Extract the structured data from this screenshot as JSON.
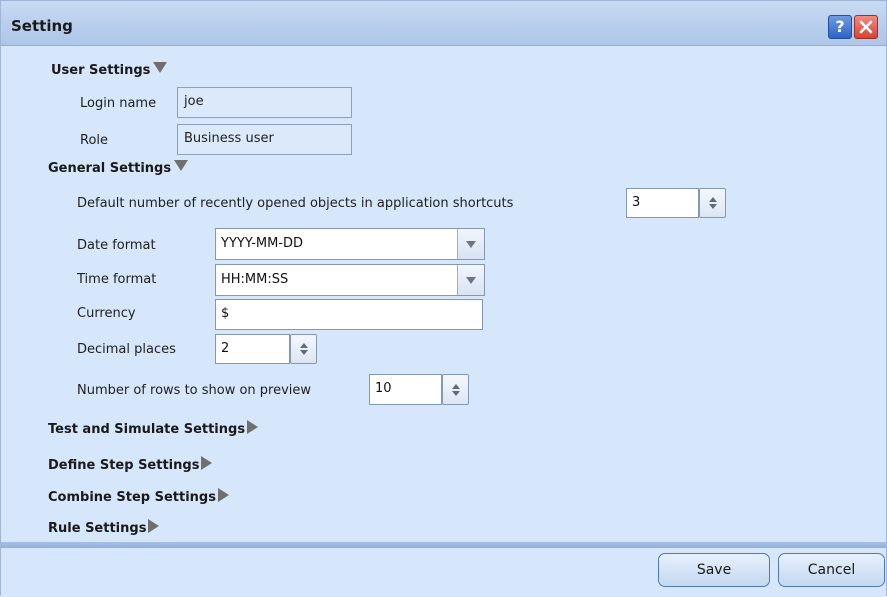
{
  "window": {
    "title": "Setting",
    "help_label": "?"
  },
  "user_settings": {
    "header": "User Settings",
    "login_label": "Login name",
    "login_value": "joe",
    "role_label": "Role",
    "role_value": "Business user"
  },
  "general_settings": {
    "header": "General Settings",
    "recent_label": "Default number of recently opened objects in application shortcuts",
    "recent_value": "3",
    "date_label": "Date format",
    "date_value": "YYYY-MM-DD",
    "time_label": "Time format",
    "time_value": "HH:MM:SS",
    "currency_label": "Currency",
    "currency_value": "$",
    "decimal_label": "Decimal places",
    "decimal_value": "2",
    "rows_label": "Number of rows to show on preview",
    "rows_value": "10"
  },
  "collapsed_sections": {
    "test_simulate": "Test and Simulate Settings",
    "define_step": "Define Step Settings",
    "combine_step": "Combine Step Settings",
    "rule": "Rule Settings"
  },
  "buttons": {
    "save": "Save",
    "cancel": "Cancel"
  },
  "icons": {
    "help": "help-icon",
    "close": "close-icon",
    "expanded": "triangle-down-icon",
    "collapsed": "triangle-right-icon",
    "spinner": "spinner-arrows-icon",
    "dropdown": "chevron-down-icon"
  },
  "colors": {
    "dialog_bg": "#d6e6fb",
    "title_bar": "#b7cdec",
    "help_button": "#2f64c5",
    "close_button": "#d64435",
    "button_border": "#4d79b8"
  }
}
